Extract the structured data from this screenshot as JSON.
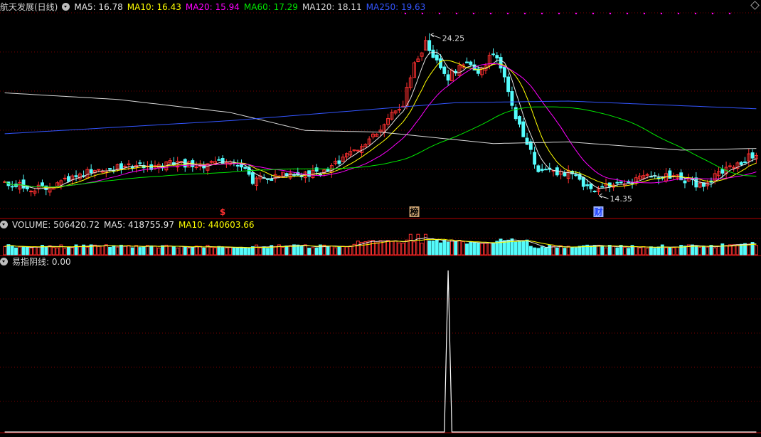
{
  "colors": {
    "up": "#ff3030",
    "down": "#54fcfc",
    "ma5": "#e6e6e6",
    "ma10": "#ffff00",
    "ma20": "#ff00ff",
    "ma60": "#00e600",
    "ma120": "#d8d8d8",
    "ma250": "#3355ff",
    "grid": "#7a0000",
    "sep": "#b40000"
  },
  "header": {
    "title": "航天发展(日线)",
    "ma5": "MA5: 16.78",
    "ma10": "MA10: 16.43",
    "ma20": "MA20: 15.94",
    "ma60": "MA60: 17.29",
    "ma120": "MA120: 18.11",
    "ma250": "MA250: 19.63"
  },
  "volume_header": {
    "volume": "VOLUME: 506420.72",
    "ma5": "MA5: 418755.97",
    "ma10": "MA10: 440603.66"
  },
  "indicator_header": {
    "name": "易指阴线",
    "value": ": 0.00"
  },
  "price_labels": {
    "high": "24.25",
    "low": "14.35"
  },
  "markers": [
    "$",
    "榜",
    "财"
  ],
  "chart_data": [
    {
      "type": "candlestick",
      "ylim": [
        13.0,
        25.5
      ],
      "start_close": 15.1,
      "close_path": [
        [
          0,
          15.1
        ],
        [
          8,
          14.75
        ],
        [
          14,
          15.0
        ],
        [
          22,
          15.7
        ],
        [
          30,
          16.0
        ],
        [
          38,
          16.1
        ],
        [
          46,
          16.3
        ],
        [
          54,
          16.1
        ],
        [
          60,
          16.6
        ],
        [
          64,
          15.9
        ],
        [
          66,
          15.2
        ],
        [
          72,
          15.5
        ],
        [
          80,
          15.6
        ],
        [
          86,
          15.9
        ],
        [
          94,
          17.3
        ],
        [
          100,
          18.4
        ],
        [
          106,
          20.0
        ],
        [
          109,
          22.5
        ],
        [
          112,
          23.6
        ],
        [
          114,
          22.8
        ],
        [
          118,
          21.6
        ],
        [
          122,
          22.4
        ],
        [
          126,
          22.0
        ],
        [
          130,
          22.9
        ],
        [
          132,
          22.2
        ],
        [
          136,
          19.2
        ],
        [
          139,
          17.5
        ],
        [
          142,
          15.8
        ],
        [
          150,
          15.7
        ],
        [
          155,
          14.85
        ],
        [
          158,
          14.6
        ],
        [
          162,
          15.1
        ],
        [
          168,
          15.3
        ],
        [
          172,
          15.4
        ],
        [
          178,
          15.6
        ],
        [
          182,
          15.2
        ],
        [
          186,
          14.8
        ],
        [
          190,
          15.8
        ],
        [
          196,
          16.4
        ],
        [
          200,
          16.9
        ]
      ],
      "high_extreme": 24.25,
      "low_extreme": 14.35,
      "ma_last": {
        "ma5": 16.78,
        "ma10": 16.43,
        "ma20": 15.94,
        "ma60": 17.29,
        "ma120": 18.11,
        "ma250": 19.63
      },
      "ma250_path": [
        [
          0,
          18.1
        ],
        [
          60,
          18.9
        ],
        [
          120,
          20.0
        ],
        [
          150,
          20.1
        ],
        [
          200,
          19.63
        ]
      ],
      "ma120_path": [
        [
          0,
          20.6
        ],
        [
          30,
          20.2
        ],
        [
          60,
          19.4
        ],
        [
          80,
          18.3
        ],
        [
          100,
          18.2
        ],
        [
          130,
          17.5
        ],
        [
          150,
          17.6
        ],
        [
          180,
          17.1
        ],
        [
          200,
          17.2
        ]
      ]
    },
    {
      "type": "bar",
      "series": "volume",
      "ylim": [
        0,
        1000000
      ],
      "last": 506420.72,
      "ma5_last": 418755.97,
      "ma10_last": 440603.66
    },
    {
      "type": "line",
      "series": "易指阴线",
      "ylim": [
        0,
        1
      ],
      "spike_index": 118,
      "spike_value": 1,
      "last": 0.0
    }
  ]
}
